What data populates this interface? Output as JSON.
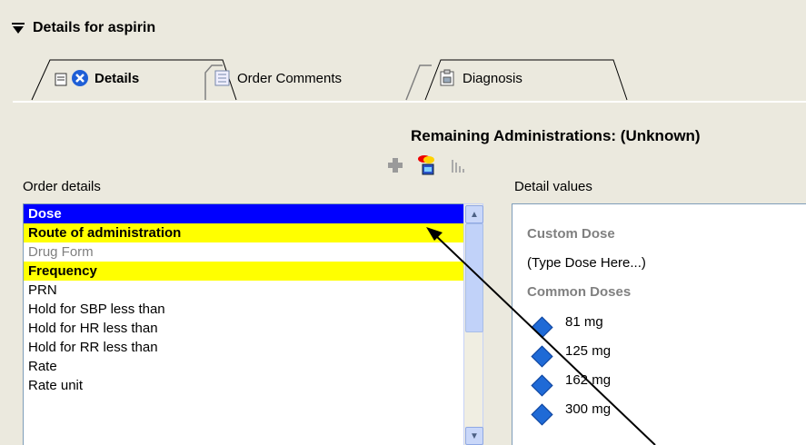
{
  "header": {
    "title": "Details for aspirin"
  },
  "tabs": [
    {
      "label": "Details",
      "icon": "details-icon"
    },
    {
      "label": "Order Comments",
      "icon": "comments-icon"
    },
    {
      "label": "Diagnosis",
      "icon": "diagnosis-icon"
    }
  ],
  "remaining_admin": "Remaining Administrations: (Unknown)",
  "order_details": {
    "label": "Order details",
    "items": [
      {
        "label": "Dose",
        "state": "selected"
      },
      {
        "label": "Route of administration",
        "state": "required"
      },
      {
        "label": "Drug Form",
        "state": "disabled"
      },
      {
        "label": "Frequency",
        "state": "required"
      },
      {
        "label": "PRN",
        "state": "normal"
      },
      {
        "label": "Hold for SBP less than",
        "state": "normal"
      },
      {
        "label": "Hold for HR less than",
        "state": "normal"
      },
      {
        "label": "Hold for RR less than",
        "state": "normal"
      },
      {
        "label": "Rate",
        "state": "normal"
      },
      {
        "label": "Rate unit",
        "state": "normal"
      }
    ]
  },
  "detail_values": {
    "label": "Detail values",
    "custom_dose_header": "Custom Dose",
    "custom_dose_placeholder": "(Type Dose Here...)",
    "common_doses_header": "Common Doses",
    "doses": [
      "81 mg",
      "125 mg",
      "162 mg",
      "300 mg"
    ]
  },
  "toolbar": {
    "icons": [
      "add-icon",
      "pills-icon",
      "chart-icon"
    ]
  },
  "colors": {
    "selected": "#0000ff",
    "required": "#ffff00",
    "panel_bg": "#ebe9de",
    "diamond": "#1f6ad6"
  }
}
